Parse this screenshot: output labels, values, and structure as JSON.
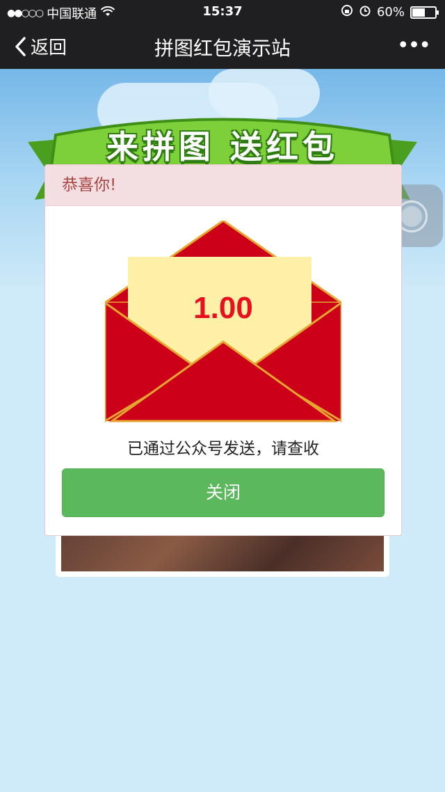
{
  "status_bar": {
    "signal": "●●○○○",
    "carrier": "中国联通",
    "time": "15:37",
    "battery_percent": "60%",
    "battery_level": 0.6
  },
  "nav": {
    "back_label": "返回",
    "title": "拼图红包演示站",
    "more_label": "•••"
  },
  "banner": {
    "text": "来拼图  送红包"
  },
  "dialog": {
    "header": "恭喜你!",
    "amount": "1.00",
    "message": "已通过公众号发送，请查收",
    "close_label": "关闭"
  },
  "colors": {
    "envelope_red": "#cc0019",
    "envelope_border": "#e5a531",
    "letter": "#fff0a8",
    "button_green": "#5cb85c"
  }
}
